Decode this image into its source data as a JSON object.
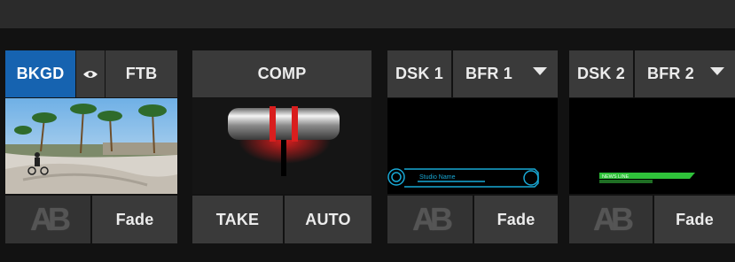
{
  "bkgd": {
    "bkgd_label": "BKGD",
    "eye_icon": "eye-icon",
    "ftb_label": "FTB",
    "ab_glyph": [
      "A",
      "B"
    ],
    "fade_label": "Fade"
  },
  "comp": {
    "comp_label": "COMP",
    "take_label": "TAKE",
    "auto_label": "AUTO"
  },
  "dsk1": {
    "dsk_label": "DSK 1",
    "buffer_label": "BFR 1",
    "preview_title": "Studio Name",
    "ab_glyph": [
      "A",
      "B"
    ],
    "fade_label": "Fade"
  },
  "dsk2": {
    "dsk_label": "DSK 2",
    "buffer_label": "BFR 2",
    "preview_title": "NEWS LINE",
    "ab_glyph": [
      "A",
      "B"
    ],
    "fade_label": "Fade"
  },
  "colors": {
    "active_blue": "#1663b0",
    "tbar_red": "#e02020",
    "dsk1_graphic": "#19a9d6",
    "dsk2_graphic": "#2fc23a"
  }
}
